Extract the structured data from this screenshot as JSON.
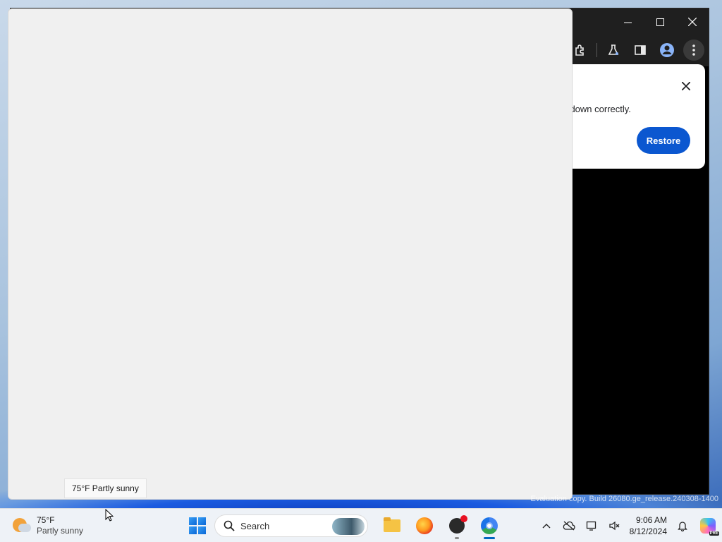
{
  "chrome": {
    "window_controls": {
      "minimize": "—",
      "maximize": "☐",
      "close": "✕"
    },
    "toolbar_icons": [
      "extensions-icon",
      "labs-icon",
      "side-panel-icon",
      "profile-icon",
      "menu-icon"
    ]
  },
  "restore_dialog": {
    "message": "ut down correctly.",
    "close": "✕",
    "button": "Restore"
  },
  "weather_tooltip": "75°F Partly sunny",
  "watermark": "Evaluation copy. Build 26080.ge_release.240308-1400",
  "taskbar": {
    "weather": {
      "temp": "75°F",
      "desc": "Partly sunny"
    },
    "search": {
      "label": "Search"
    },
    "pinned_apps": [
      "file-explorer-icon",
      "firefox-icon",
      "dev-app-icon",
      "chrome-icon"
    ],
    "tray": {
      "overflow": "^"
    },
    "clock": {
      "time": "9:06 AM",
      "date": "8/12/2024"
    },
    "copilot_badge": "PRE"
  },
  "colors": {
    "accent": "#0b57d0",
    "taskbar_indicator": "#0067c0",
    "blank_window": "#f0f0f0"
  }
}
